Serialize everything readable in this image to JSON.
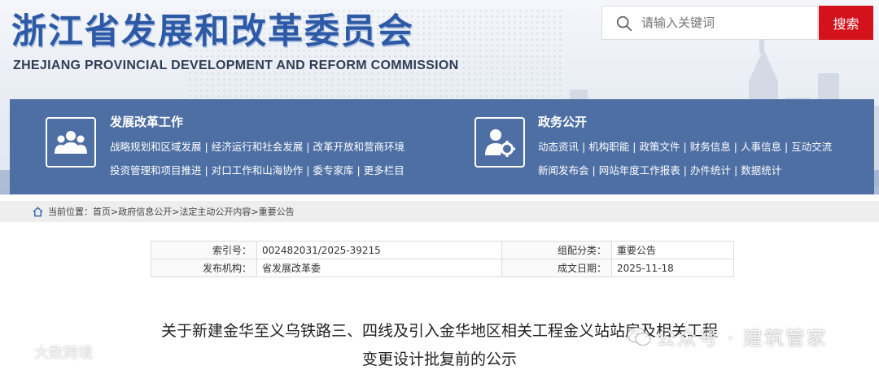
{
  "header": {
    "title_cn": "浙江省发展和改革委员会",
    "title_en": "ZHEJIANG PROVINCIAL DEVELOPMENT AND REFORM COMMISSION"
  },
  "search": {
    "placeholder": "请输入关键词",
    "button_label": "搜索"
  },
  "nav": {
    "groups": [
      {
        "heading": "发展改革工作",
        "icon": "people-group-icon",
        "lines": [
          [
            "战略规划和区域发展",
            "经济运行和社会发展",
            "改革开放和营商环境"
          ],
          [
            "投资管理和项目推进",
            "对口工作和山海协作",
            "委专家库",
            "更多栏目"
          ]
        ]
      },
      {
        "heading": "政务公开",
        "icon": "user-gear-icon",
        "lines": [
          [
            "动态资讯",
            "机构职能",
            "政策文件",
            "财务信息",
            "人事信息",
            "互动交流"
          ],
          [
            "新闻发布会",
            "网站年度工作报表",
            "办件统计",
            "数据统计"
          ]
        ]
      }
    ]
  },
  "breadcrumb": {
    "label": "当前位置：",
    "items": [
      "首页",
      "政府信息公开",
      "法定主动公开内容",
      "重要公告"
    ],
    "separator": ">"
  },
  "meta": {
    "index_label": "索引号：",
    "index_value": "002482031/2025-39215",
    "category_label": "组配分类：",
    "category_value": "重要公告",
    "publisher_label": "发布机构：",
    "publisher_value": "省发展改革委",
    "date_label": "成文日期：",
    "date_value": "2025-11-18"
  },
  "article": {
    "title_line1": "关于新建金华至义乌铁路三、四线及引入金华地区相关工程金义站站房及相关工程",
    "title_line2": "变更设计批复前的公示"
  },
  "watermarks": {
    "left": "大数跨境",
    "right": "公众号 · 建筑管家"
  },
  "colors": {
    "brand_blue": "#2d5aa6",
    "nav_blue": "#4d6fa4",
    "search_red": "#d4121b"
  }
}
